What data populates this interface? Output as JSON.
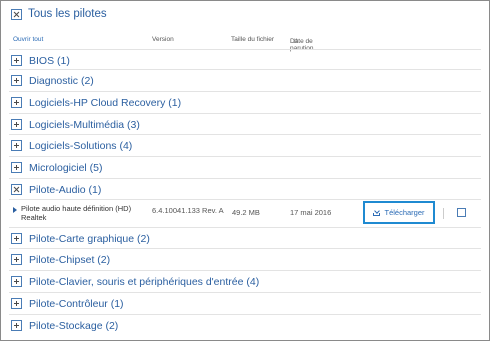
{
  "header": {
    "title": "Tous les pilotes",
    "open_all": "Ouvrir tout",
    "col_version": "Version",
    "col_size": "Taille du fichier",
    "col_date": "Date de parution"
  },
  "categories": [
    {
      "label": "BIOS (1)"
    },
    {
      "label": "Diagnostic (2)"
    },
    {
      "label": "Logiciels-HP Cloud Recovery (1)"
    },
    {
      "label": "Logiciels-Multimédia (3)"
    },
    {
      "label": "Logiciels-Solutions (4)"
    },
    {
      "label": "Micrologiciel (5)"
    },
    {
      "label": "Pilote-Audio (1)"
    },
    {
      "label": "Pilote-Carte graphique (2)"
    },
    {
      "label": "Pilote-Chipset (2)"
    },
    {
      "label": "Pilote-Clavier, souris et périphériques d'entrée (4)"
    },
    {
      "label": "Pilote-Contrôleur (1)"
    },
    {
      "label": "Pilote-Stockage (2)"
    }
  ],
  "driver": {
    "name": "Pilote audio haute définition (HD) Realtek",
    "version": "6.4.10041.133 Rev. A",
    "size": "49.2 MB",
    "date": "17 mai 2016",
    "download": "Télécharger"
  }
}
